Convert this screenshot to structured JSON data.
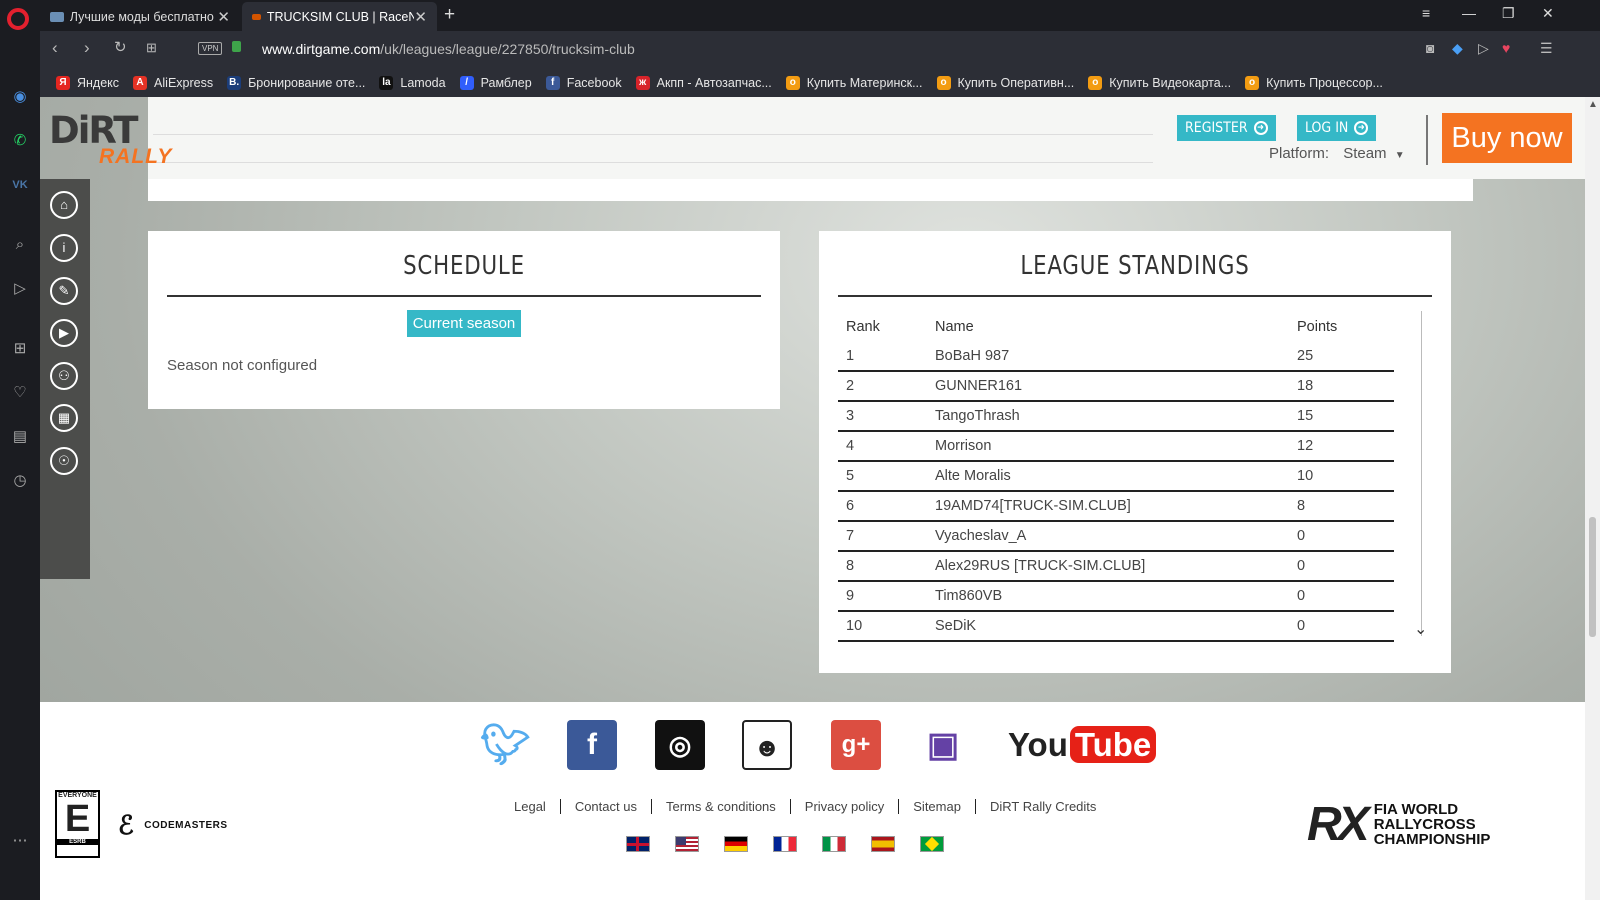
{
  "browser": {
    "tabs": [
      {
        "title": "Лучшие моды бесплатно"
      },
      {
        "title": "TRUCKSIM CLUB | RaceNet"
      }
    ],
    "url_domain": "www.dirtgame.com",
    "url_path": "/uk/leagues/league/227850/trucksim-club",
    "vpn_label": "VPN",
    "bookmarks": [
      {
        "label": "Яндекс",
        "color": "#e52620",
        "icon": "Я"
      },
      {
        "label": "AliExpress",
        "color": "#e43225",
        "icon": "A"
      },
      {
        "label": "Бронирование оте...",
        "color": "#1b3d7a",
        "icon": "B."
      },
      {
        "label": "Lamoda",
        "color": "#111111",
        "icon": "la"
      },
      {
        "label": "Рамблер",
        "color": "#315efb",
        "icon": "/"
      },
      {
        "label": "Facebook",
        "color": "#3b5998",
        "icon": "f"
      },
      {
        "label": "Акпп - Автозапчас...",
        "color": "#d8232a",
        "icon": "ж"
      },
      {
        "label": "Купить Материнск...",
        "color": "#f39c12",
        "icon": "o"
      },
      {
        "label": "Купить Оперативн...",
        "color": "#f39c12",
        "icon": "o"
      },
      {
        "label": "Купить Видеокарта...",
        "color": "#f39c12",
        "icon": "o"
      },
      {
        "label": "Купить Процессор...",
        "color": "#f39c12",
        "icon": "o"
      }
    ]
  },
  "header": {
    "logo_main": "DiRT",
    "logo_sub": "RALLY",
    "register_label": "REGISTER",
    "login_label": "LOG IN",
    "platform_label": "Platform:",
    "platform_value": "Steam",
    "buy_now_label": "Buy now",
    "accent_color": "#35b8c7",
    "brand_color": "#f47321"
  },
  "schedule": {
    "title": "SCHEDULE",
    "season_button": "Current season",
    "message": "Season not configured"
  },
  "standings": {
    "title": "LEAGUE STANDINGS",
    "columns": {
      "rank": "Rank",
      "name": "Name",
      "points": "Points"
    },
    "rows": [
      {
        "rank": "1",
        "name": "BoBaH 987",
        "points": "25"
      },
      {
        "rank": "2",
        "name": "GUNNER161",
        "points": "18"
      },
      {
        "rank": "3",
        "name": "TangoThrash",
        "points": "15"
      },
      {
        "rank": "4",
        "name": "Morrison",
        "points": "12"
      },
      {
        "rank": "5",
        "name": "Alte Moralis",
        "points": "10"
      },
      {
        "rank": "6",
        "name": "19AMD74[TRUCK-SIM.CLUB]",
        "points": "8"
      },
      {
        "rank": "7",
        "name": "Vyacheslav_A",
        "points": "0"
      },
      {
        "rank": "8",
        "name": "Alex29RUS [TRUCK-SIM.CLUB]",
        "points": "0"
      },
      {
        "rank": "9",
        "name": "Tim860VB",
        "points": "0"
      },
      {
        "rank": "10",
        "name": "SeDiK",
        "points": "0"
      }
    ]
  },
  "footer": {
    "youtube_you": "You",
    "youtube_tube": "Tube",
    "links": [
      "Legal",
      "Contact us",
      "Terms & conditions",
      "Privacy policy",
      "Sitemap",
      "DiRT Rally Credits"
    ],
    "esrb_top": "EVERYONE",
    "esrb_letter": "E",
    "esrb_bottom": "ESRB",
    "codemasters": "CODEMASTERS",
    "rx_mark": "RX",
    "rx_line1": "FIA WORLD",
    "rx_line2": "RALLYCROSS",
    "rx_line3": "CHAMPIONSHIP"
  }
}
